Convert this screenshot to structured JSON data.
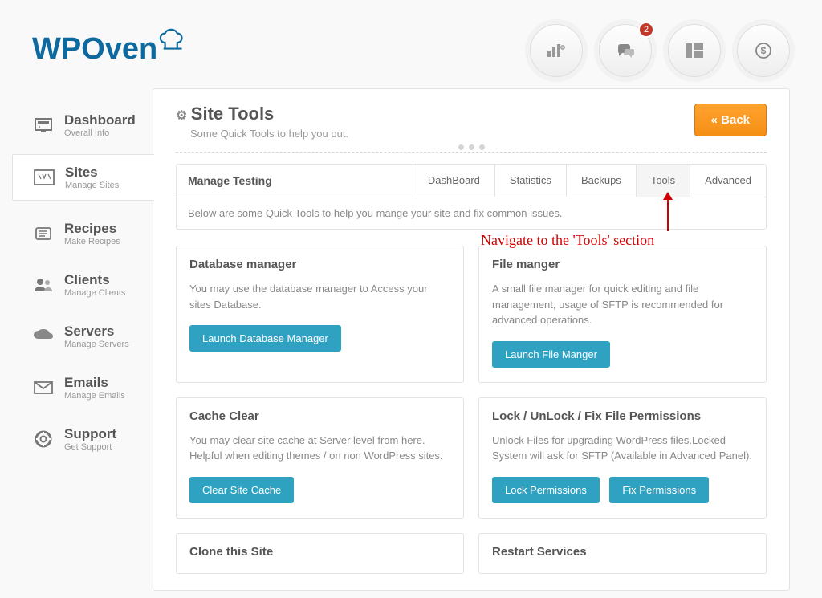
{
  "brand": "WPOven",
  "header": {
    "notif_count": "2"
  },
  "nav": [
    {
      "label": "Dashboard",
      "sub": "Overall Info"
    },
    {
      "label": "Sites",
      "sub": "Manage Sites"
    },
    {
      "label": "Recipes",
      "sub": "Make Recipes"
    },
    {
      "label": "Clients",
      "sub": "Manage Clients"
    },
    {
      "label": "Servers",
      "sub": "Manage Servers"
    },
    {
      "label": "Emails",
      "sub": "Manage Emails"
    },
    {
      "label": "Support",
      "sub": "Get Support"
    }
  ],
  "page": {
    "title": "Site Tools",
    "subtitle": "Some Quick Tools to help you out.",
    "back": "Back"
  },
  "tabs": {
    "siteLabel": "Manage Testing",
    "items": [
      "DashBoard",
      "Statistics",
      "Backups",
      "Tools",
      "Advanced"
    ],
    "desc": "Below are some Quick Tools to help you mange your site and fix common issues."
  },
  "tools": [
    {
      "title": "Database manager",
      "desc": "You may use the database manager to Access your sites Database.",
      "buttons": [
        "Launch Database Manager"
      ]
    },
    {
      "title": "File manger",
      "desc": "A small file manager for quick editing and file management, usage of SFTP is recommended for advanced operations.",
      "buttons": [
        "Launch File Manger"
      ]
    },
    {
      "title": "Cache Clear",
      "desc": "You may clear site cache at Server level from here. Helpful when editing themes / on non WordPress sites.",
      "buttons": [
        "Clear Site Cache"
      ]
    },
    {
      "title": "Lock / UnLock / Fix File Permissions",
      "desc": "Unlock Files for upgrading WordPress files.Locked System will ask for SFTP (Available in Advanced Panel).",
      "buttons": [
        "Lock Permissions",
        "Fix Permissions"
      ]
    },
    {
      "title": "Clone this Site",
      "desc": "",
      "buttons": []
    },
    {
      "title": "Restart Services",
      "desc": "",
      "buttons": []
    }
  ],
  "annotation": "Navigate to the 'Tools' section"
}
